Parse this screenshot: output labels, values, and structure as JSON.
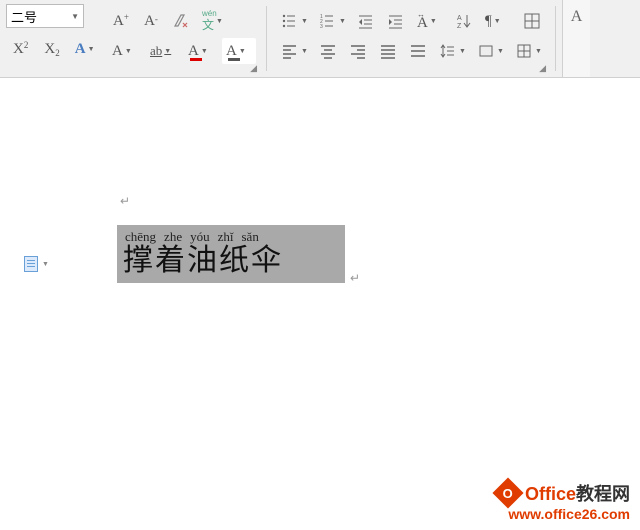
{
  "ribbon": {
    "font_size_value": "二号",
    "icons": {
      "grow_font": "A⁺",
      "shrink_font": "A⁻",
      "clear_format": "◇",
      "phonetic": "拼",
      "superscript": "X²",
      "subscript": "X₂",
      "text_effects": "A",
      "char_shading": "A",
      "strike": "ab",
      "font_color": "A",
      "highlight": "A",
      "bullets": "•",
      "numbering": "1.",
      "dec_indent": "⇤",
      "inc_indent": "⇥",
      "char_scale": "↔A",
      "sort": "A↓",
      "show_marks": "¶",
      "table": "▦",
      "align_left": "≡",
      "align_center": "≡",
      "align_right": "≡",
      "justify": "≡",
      "distribute": "≡",
      "line_spacing": "‖",
      "shading": "▭",
      "borders": "⊞",
      "select": "A"
    }
  },
  "document": {
    "pinyin": [
      "chēng",
      "zhe",
      "yóu",
      "zhǐ",
      "sǎn"
    ],
    "hanzi": "撑着油纸伞"
  },
  "watermark": {
    "brand_cn": "教程网",
    "brand_en": "Office",
    "url": "www.office26.com"
  }
}
